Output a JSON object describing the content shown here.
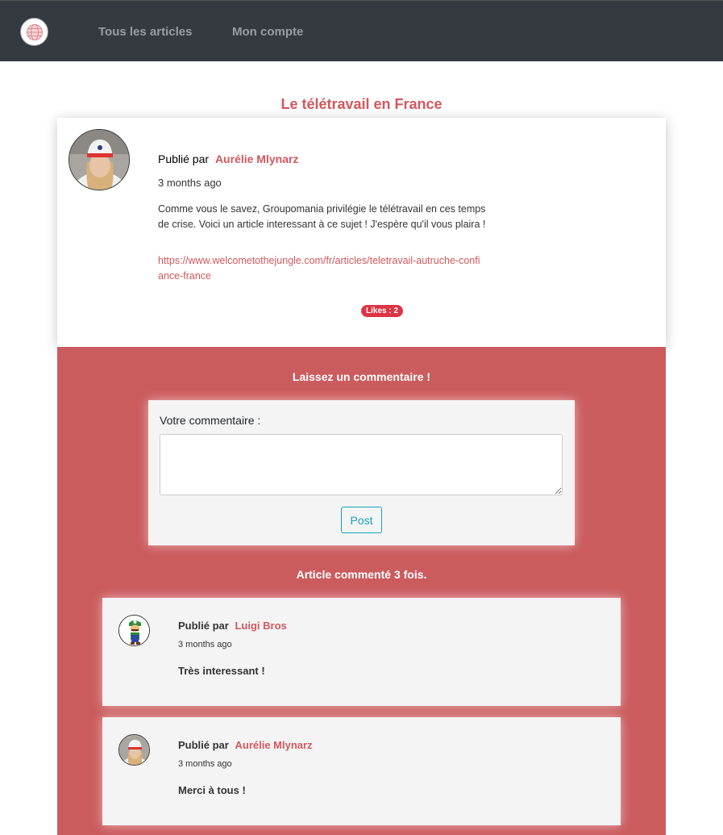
{
  "nav": {
    "logo_icon": "globe-icon",
    "articles_label": "Tous les articles",
    "account_label": "Mon compte"
  },
  "article": {
    "title": "Le télétravail en France",
    "published_by": "Publié par",
    "author": "Aurélie Mlynarz",
    "date": "3 months ago",
    "content": "Comme vous le savez, Groupomania privilégie le télétravail en ces temps de crise. Voici un article interessant à ce sujet ! J'espère qu'il vous plaira !",
    "link": "https://www.welcometothejungle.com/fr/articles/teletravail-autruche-confiance-france",
    "likes": "Likes : 2"
  },
  "comment_form": {
    "title": "Laissez un commentaire !",
    "label": "Votre commentaire :",
    "textarea_value": "",
    "post_label": "Post"
  },
  "comments": {
    "count_text": "Article commenté 3 fois.",
    "items": [
      {
        "published_by": "Publié par",
        "author": "Luigi Bros",
        "date": "3 months ago",
        "text": "Très interessant !"
      },
      {
        "published_by": "Publié par",
        "author": "Aurélie Mlynarz",
        "date": "3 months ago",
        "text": "Merci à tous !"
      }
    ]
  },
  "colors": {
    "navbar": "#343a40",
    "accent": "#d2585d",
    "comment_section": "#cb5c5e",
    "likes_badge": "#dc3545",
    "post_button": "#17a2b8"
  }
}
